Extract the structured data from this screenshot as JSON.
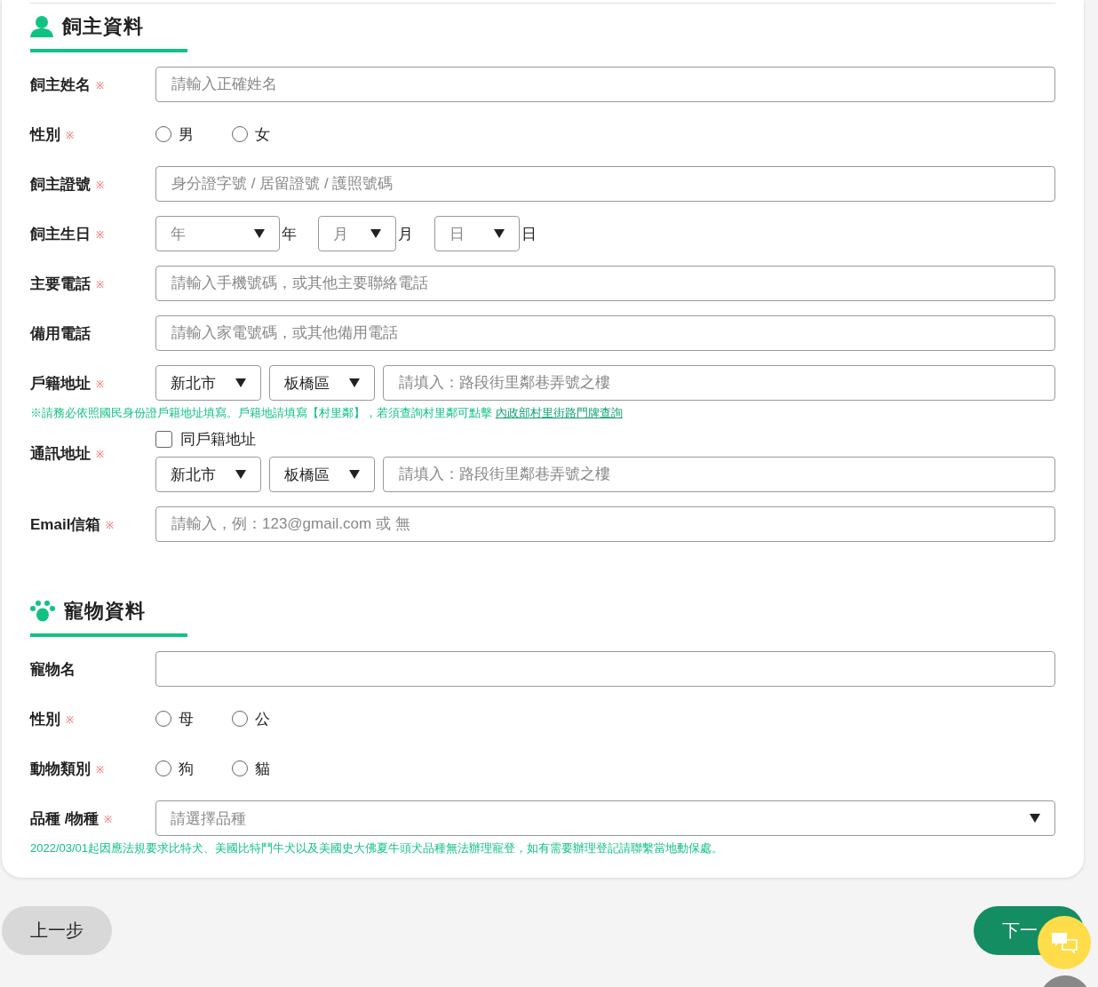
{
  "owner_section": {
    "title": "飼主資料",
    "kind": "owner",
    "fields": [
      {
        "kind": "text",
        "label": "飼主姓名",
        "mark": "※",
        "placeholder": "請輸入正確姓名"
      },
      {
        "kind": "radio",
        "label": "性別",
        "mark": "※",
        "options": [
          {
            "label": "男",
            "selected": false
          },
          {
            "label": "女",
            "selected": false
          }
        ]
      },
      {
        "kind": "text",
        "label": "飼主證號",
        "mark": "※",
        "placeholder": "身分證字號 / 居留證號 / 護照號碼"
      },
      {
        "kind": "date",
        "label": "飼主生日",
        "mark": "※",
        "parts": [
          {
            "placeholder": "年",
            "unit": "年"
          },
          {
            "placeholder": "月",
            "unit": "月"
          },
          {
            "placeholder": "日",
            "unit": "日"
          }
        ]
      },
      {
        "kind": "text",
        "label": "主要電話",
        "mark": "※",
        "placeholder": "請輸入手機號碼，或其他主要聯絡電話"
      },
      {
        "kind": "text",
        "label": "備用電話",
        "placeholder": "請輸入家電號碼，或其他備用電話"
      },
      {
        "kind": "address",
        "label": "戶籍地址",
        "mark": "※",
        "city": "新北市",
        "district": "板橋區",
        "placeholder": "請填入：路段街里鄰巷弄號之樓",
        "note": {
          "text": "※請務必依照國民身份證戶籍地址填寫。戶籍地請填寫【村里鄰】，若須查詢村里鄰可點擊",
          "link": "內政部村里街路門牌查詢"
        }
      },
      {
        "kind": "address",
        "label": "通訊地址",
        "mark": "※",
        "checkbox": {
          "label": "同戶籍地址",
          "checked": false
        },
        "city": "新北市",
        "district": "板橋區",
        "placeholder": "請填入：路段街里鄰巷弄號之樓"
      },
      {
        "kind": "text",
        "label": "Email信箱",
        "mark": "※",
        "placeholder": "請輸入，例：123@gmail.com 或 無"
      }
    ]
  },
  "pet_section": {
    "title": "寵物資料",
    "kind": "pet",
    "fields": [
      {
        "kind": "text",
        "label": "寵物名"
      },
      {
        "kind": "radio",
        "label": "性別",
        "mark": "※",
        "options": [
          {
            "label": "母",
            "selected": false
          },
          {
            "label": "公",
            "selected": false
          }
        ]
      },
      {
        "kind": "radio",
        "label": "動物類別",
        "mark": "※",
        "options": [
          {
            "label": "狗",
            "selected": false
          },
          {
            "label": "貓",
            "selected": false
          }
        ]
      },
      {
        "kind": "select",
        "label": "品種 /物種",
        "mark": "※",
        "placeholder": "請選擇品種",
        "note": {
          "text": "2022/03/01起因應法規要求比特犬、美國比特鬥牛犬以及美國史大佛夏牛頭犬品種無法辦理寵登，如有需要辦理登記請聯繫當地動保處。"
        }
      }
    ]
  },
  "buttons": [
    {
      "kind": "back",
      "label": "上一步"
    },
    {
      "kind": "next",
      "label": "下一"
    }
  ]
}
